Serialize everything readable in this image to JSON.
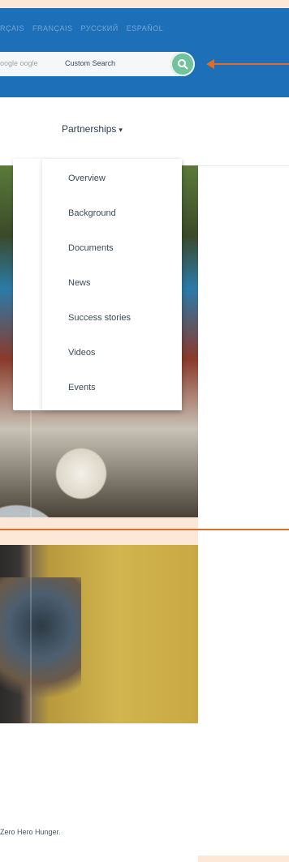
{
  "header": {
    "languages": [
      "RÇAIS",
      "FRANÇAIS",
      "РУССКИЙ",
      "ESPAÑOL"
    ],
    "search": {
      "ghost_text": "oogle oogle",
      "label": "Custom Search",
      "button_icon": "search-icon"
    }
  },
  "nav": {
    "partnerships_label": "Partnerships",
    "menu": [
      "Overview",
      "Background",
      "Documents",
      "News",
      "Success stories",
      "Videos",
      "Events"
    ]
  },
  "card": {
    "caption": "Zero Hero Hunger."
  },
  "colors": {
    "topbar": "#1d6fb8",
    "accent_arrow": "#e06c25",
    "search_button": "#72c29c",
    "page_background": "#fde7d6"
  }
}
